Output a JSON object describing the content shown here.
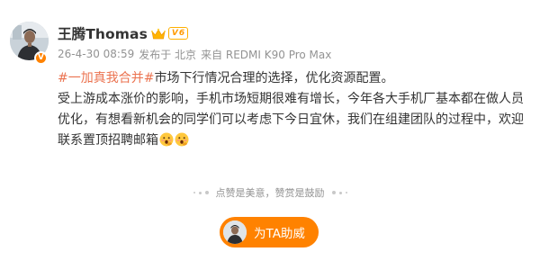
{
  "post": {
    "author": {
      "name": "王腾Thomas",
      "level": "6",
      "verified_icon": "v-badge-icon",
      "crown_icon": "crown-icon"
    },
    "meta": {
      "date": "26-4-30 08:59",
      "location": "发布于 北京",
      "source": "来自 REDMI K90 Pro Max"
    },
    "content": {
      "topic": "#一加真我合并#",
      "line1_rest": "市场下行情况合理的选择，优化资源配置。",
      "paragraph2": "受上游成本涨价的影响，手机市场短期很难有增长，今年各大手机厂基本都在做人员优化，有想看新机会的同学们可以考虑下今日宜休，我们在组建团队的过程中，欢迎联系置顶招聘邮箱",
      "emojis": [
        "face-with-hand-over-mouth-emoji",
        "face-with-hand-over-mouth-emoji"
      ]
    },
    "like_tip": "点赞是美意，赞赏是鼓励",
    "tip_button": "为TA助威",
    "colors": {
      "topic": "#eb7350",
      "accent": "#ff8200",
      "meta": "#939393",
      "text": "#333333"
    }
  }
}
